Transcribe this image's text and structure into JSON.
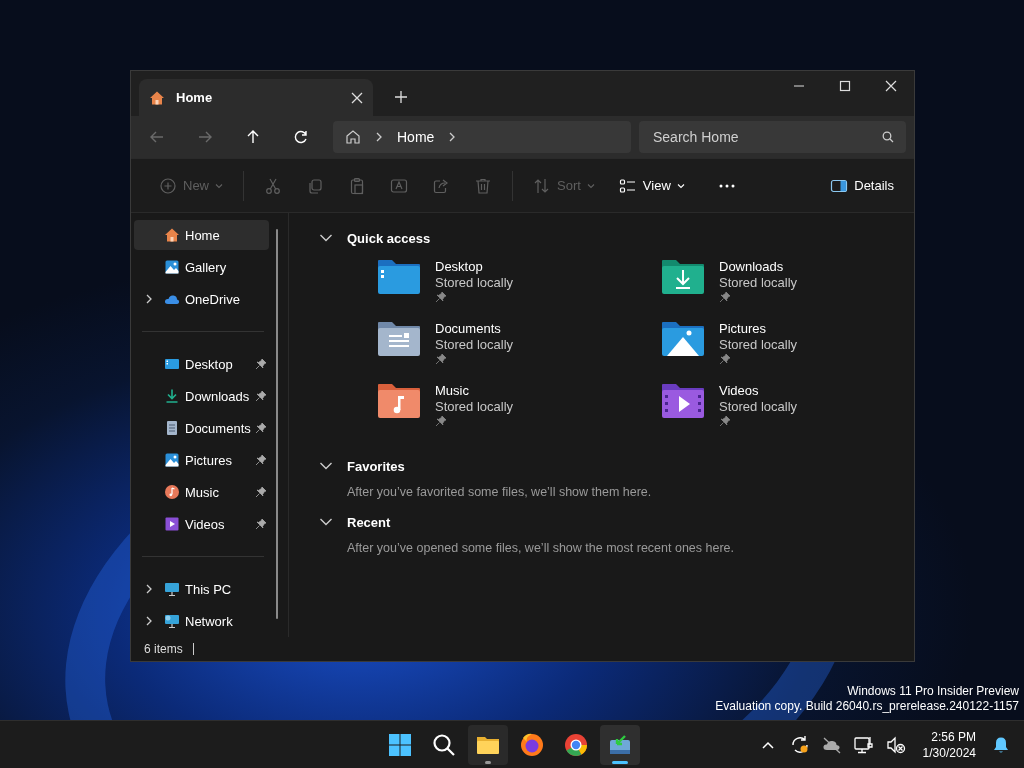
{
  "window": {
    "tabs": [
      {
        "label": "Home",
        "selected": true
      }
    ]
  },
  "nav_buttons": [
    {
      "kind": "back",
      "disabled": true
    },
    {
      "kind": "forward",
      "disabled": true
    },
    {
      "kind": "up",
      "disabled": false
    },
    {
      "kind": "refresh",
      "disabled": false
    }
  ],
  "breadcrumb": [
    "Home"
  ],
  "search": {
    "placeholder": "Search Home"
  },
  "toolbar": [
    {
      "kind": "new",
      "label": "New",
      "disabled": true
    },
    {
      "kind": "cut",
      "disabled": true
    },
    {
      "kind": "copy",
      "disabled": true
    },
    {
      "kind": "paste",
      "disabled": true
    },
    {
      "kind": "rename",
      "disabled": true
    },
    {
      "kind": "share",
      "disabled": true
    },
    {
      "kind": "delete",
      "disabled": true
    },
    {
      "kind": "sort",
      "label": "Sort",
      "disabled": true
    },
    {
      "kind": "view",
      "label": "View",
      "disabled": false
    },
    {
      "kind": "more",
      "disabled": false
    },
    {
      "kind": "details",
      "label": "Details",
      "disabled": false
    }
  ],
  "sidebar": {
    "groups": [
      [
        {
          "label": "Home",
          "kind": "home",
          "expandable": false,
          "pinned": false,
          "selected": true
        },
        {
          "label": "Gallery",
          "kind": "gallery",
          "expandable": false,
          "pinned": false,
          "selected": false
        },
        {
          "label": "OneDrive",
          "kind": "cloud",
          "expandable": true,
          "pinned": false,
          "selected": false
        }
      ],
      [
        {
          "label": "Desktop",
          "kind": "desktop",
          "expandable": false,
          "pinned": true,
          "selected": false
        },
        {
          "label": "Downloads",
          "kind": "downloads",
          "expandable": false,
          "pinned": true,
          "selected": false
        },
        {
          "label": "Documents",
          "kind": "documents",
          "expandable": false,
          "pinned": true,
          "selected": false
        },
        {
          "label": "Pictures",
          "kind": "pictures",
          "expandable": false,
          "pinned": true,
          "selected": false
        },
        {
          "label": "Music",
          "kind": "music",
          "expandable": false,
          "pinned": true,
          "selected": false
        },
        {
          "label": "Videos",
          "kind": "videos",
          "expandable": false,
          "pinned": true,
          "selected": false
        }
      ],
      [
        {
          "label": "This PC",
          "kind": "pc",
          "expandable": true,
          "pinned": false,
          "selected": false
        },
        {
          "label": "Network",
          "kind": "network",
          "expandable": true,
          "pinned": false,
          "selected": false
        }
      ]
    ]
  },
  "sections": [
    {
      "title": "Quick access",
      "expanded": true,
      "items": [
        {
          "name": "Desktop",
          "status": "Stored locally",
          "kind": "desktop",
          "pinned": true
        },
        {
          "name": "Downloads",
          "status": "Stored locally",
          "kind": "downloads",
          "pinned": true
        },
        {
          "name": "Documents",
          "status": "Stored locally",
          "kind": "documents",
          "pinned": true
        },
        {
          "name": "Pictures",
          "status": "Stored locally",
          "kind": "pictures",
          "pinned": true
        },
        {
          "name": "Music",
          "status": "Stored locally",
          "kind": "music",
          "pinned": true
        },
        {
          "name": "Videos",
          "status": "Stored locally",
          "kind": "videos",
          "pinned": true
        }
      ]
    },
    {
      "title": "Favorites",
      "expanded": true,
      "message": "After you’ve favorited some files, we’ll show them here."
    },
    {
      "title": "Recent",
      "expanded": true,
      "message": "After you’ve opened some files, we’ll show the most recent ones here."
    }
  ],
  "status_bar": {
    "count": "6 items"
  },
  "desktop_notice": [
    "Windows 11 Pro Insider Preview",
    "Evaluation copy. Build 26040.rs_prerelease.240122-1157"
  ],
  "taskbar": {
    "apps": [
      {
        "kind": "start",
        "running": false,
        "selected": false
      },
      {
        "kind": "search",
        "running": false,
        "selected": false
      },
      {
        "kind": "folder",
        "running": true,
        "selected": false
      },
      {
        "kind": "globe",
        "running": false,
        "selected": false
      },
      {
        "kind": "ring",
        "running": false,
        "selected": false
      },
      {
        "kind": "installer",
        "running": true,
        "selected": true
      }
    ],
    "tray": [
      {
        "kind": "chevron"
      },
      {
        "kind": "sync"
      },
      {
        "kind": "cloud"
      },
      {
        "kind": "network"
      },
      {
        "kind": "volume"
      }
    ],
    "time": "2:56 PM",
    "date": "1/30/2024"
  }
}
